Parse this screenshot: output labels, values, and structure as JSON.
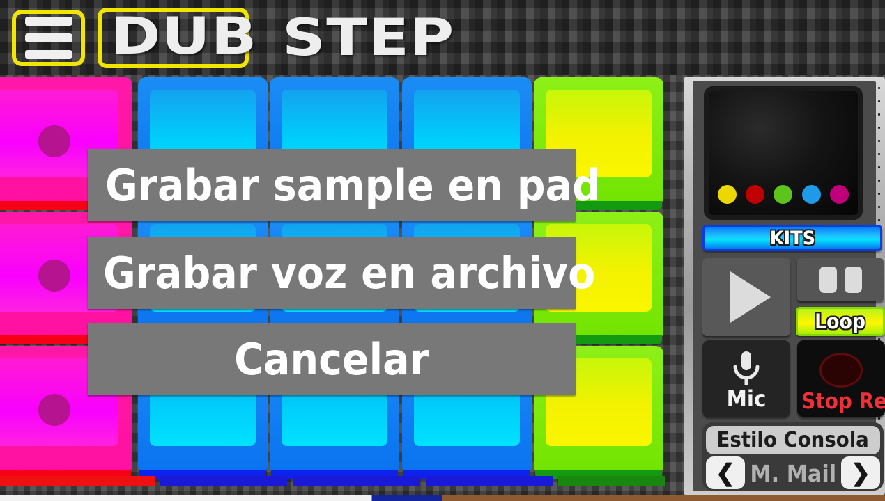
{
  "app": {
    "title_part1": "DUB",
    "title_part2": "STEP",
    "menu_icon": "hamburger-menu-icon"
  },
  "dialog": {
    "options": [
      {
        "label": "Grabar sample en pad"
      },
      {
        "label": "Grabar voz en archivo"
      },
      {
        "label": "Cancelar"
      }
    ]
  },
  "pads": {
    "rows": 3,
    "columns": 5,
    "colors": {
      "magenta": "#f900ff",
      "blue": "#00cdfb",
      "green": "#f4f200"
    },
    "grid": [
      [
        "magenta",
        "blue",
        "blue",
        "blue",
        "green"
      ],
      [
        "magenta",
        "blue",
        "blue",
        "blue",
        "green"
      ],
      [
        "magenta",
        "blue",
        "blue",
        "blue",
        "green"
      ]
    ]
  },
  "console": {
    "display": {
      "indicator_dots": [
        "#ecd800",
        "#c00000",
        "#5cc41a",
        "#1e9ae8",
        "#c0007a"
      ]
    },
    "kits_label": "KITS",
    "play_icon": "play-icon",
    "pause_icon": "pause-icon",
    "loop_label": "Loop",
    "mic_label": "Mic",
    "mic_icon": "microphone-icon",
    "stop_rec_label": "Stop Rec",
    "stop_rec_icon": "record-circle-icon",
    "style_title": "Estilo Consola",
    "style_value": "M. Mail",
    "prev_arrow": "❮",
    "next_arrow": "❯"
  },
  "bottom_strip": [
    "#ef1111",
    "#1a1ad6",
    "#1a1ad6",
    "#1a1ad6",
    "#18860f"
  ]
}
